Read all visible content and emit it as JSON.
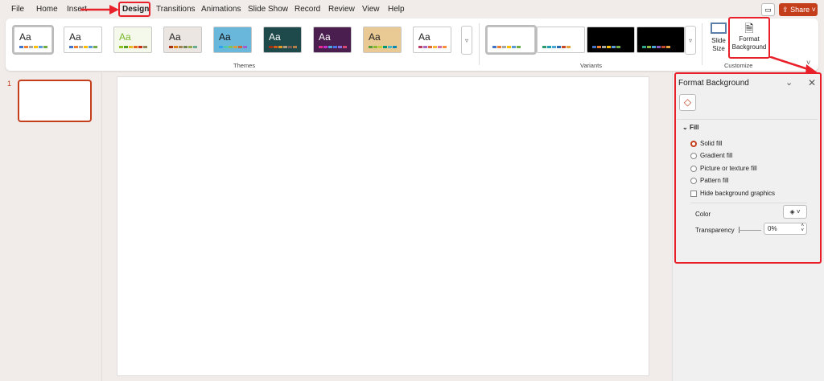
{
  "menu": {
    "items": [
      "File",
      "Home",
      "Insert",
      "Design",
      "Transitions",
      "Animations",
      "Slide Show",
      "Record",
      "Review",
      "View",
      "Help"
    ],
    "active": "Design"
  },
  "header": {
    "share_label": "Share",
    "comment_icon": "comment-icon"
  },
  "themes": {
    "label": "Themes",
    "items": [
      {
        "text": "Aa",
        "bg": "#ffffff",
        "fg": "#222",
        "sw": [
          "#4472c4",
          "#ed7d31",
          "#a5a5a5",
          "#ffc000",
          "#5b9bd5",
          "#70ad47"
        ]
      },
      {
        "text": "Aa",
        "bg": "#ffffff",
        "fg": "#222",
        "sw": [
          "#4472c4",
          "#ed7d31",
          "#a5a5a5",
          "#ffc000",
          "#5b9bd5",
          "#70ad47"
        ]
      },
      {
        "text": "Aa",
        "bg": "#f4f9ec",
        "fg": "#7ab829",
        "sw": [
          "#90c226",
          "#54a021",
          "#e6b91e",
          "#e76618",
          "#c42f1a",
          "#918655"
        ]
      },
      {
        "text": "Aa",
        "bg": "#ece6e2",
        "fg": "#222",
        "sw": [
          "#a53010",
          "#de7e18",
          "#9f8351",
          "#728653",
          "#92aa4c",
          "#6aac91"
        ]
      },
      {
        "text": "Aa",
        "bg": "#6ab7dc",
        "fg": "#111",
        "sw": [
          "#2fa3ee",
          "#4bcaad",
          "#86c157",
          "#d99c3f",
          "#ce6633",
          "#a35dd1"
        ]
      },
      {
        "text": "Aa",
        "bg": "#1f4a4c",
        "fg": "#fff",
        "sw": [
          "#a5300f",
          "#d55816",
          "#e19825",
          "#b19c7d",
          "#7f5f52",
          "#b27d49"
        ]
      },
      {
        "text": "Aa",
        "bg": "#4a1f4f",
        "fg": "#fff",
        "sw": [
          "#e32d91",
          "#c830cc",
          "#4ea6dc",
          "#4775e7",
          "#8971e1",
          "#d54773"
        ]
      },
      {
        "text": "Aa",
        "bg": "#e9c994",
        "fg": "#222",
        "sw": [
          "#549e39",
          "#8ab833",
          "#c0cf3a",
          "#029676",
          "#4ab5c4",
          "#0989b1"
        ]
      },
      {
        "text": "Aa",
        "bg": "#ffffff",
        "fg": "#222",
        "sw": [
          "#b83d68",
          "#ac66bb",
          "#de6c36",
          "#f9b639",
          "#cf6da4",
          "#fa8d3d"
        ]
      }
    ]
  },
  "variants": {
    "label": "Variants",
    "items": [
      {
        "bg": "#ffffff",
        "sw": [
          "#4472c4",
          "#ed7d31",
          "#a5a5a5",
          "#ffc000",
          "#5b9bd5",
          "#70ad47"
        ]
      },
      {
        "bg": "#ffffff",
        "sw": [
          "#2e9a6e",
          "#1fa0b3",
          "#4aa6d4",
          "#2a6bb0",
          "#c2482f",
          "#e6a13b"
        ]
      },
      {
        "bg": "#000000",
        "sw": [
          "#4472c4",
          "#ed7d31",
          "#a5a5a5",
          "#ffc000",
          "#5b9bd5",
          "#70ad47"
        ]
      },
      {
        "bg": "#000000",
        "sw": [
          "#2ea58a",
          "#8bb540",
          "#4aa6d4",
          "#8a5cc2",
          "#c2482f",
          "#e6a13b"
        ]
      }
    ]
  },
  "customize": {
    "label": "Customize",
    "slide_size": "Slide Size",
    "format_background": "Format Background"
  },
  "slides": {
    "number": "1"
  },
  "pane": {
    "title": "Format Background",
    "section": "Fill",
    "options": [
      "Solid fill",
      "Gradient fill",
      "Picture or texture fill",
      "Pattern fill"
    ],
    "selected": "Solid fill",
    "hide_graphics": "Hide background graphics",
    "hide_checked": false,
    "color_label": "Color",
    "transparency_label": "Transparency",
    "transparency_value": "0%"
  },
  "colors": {
    "accent": "#c43e1c",
    "annotation": "#e8202a"
  }
}
